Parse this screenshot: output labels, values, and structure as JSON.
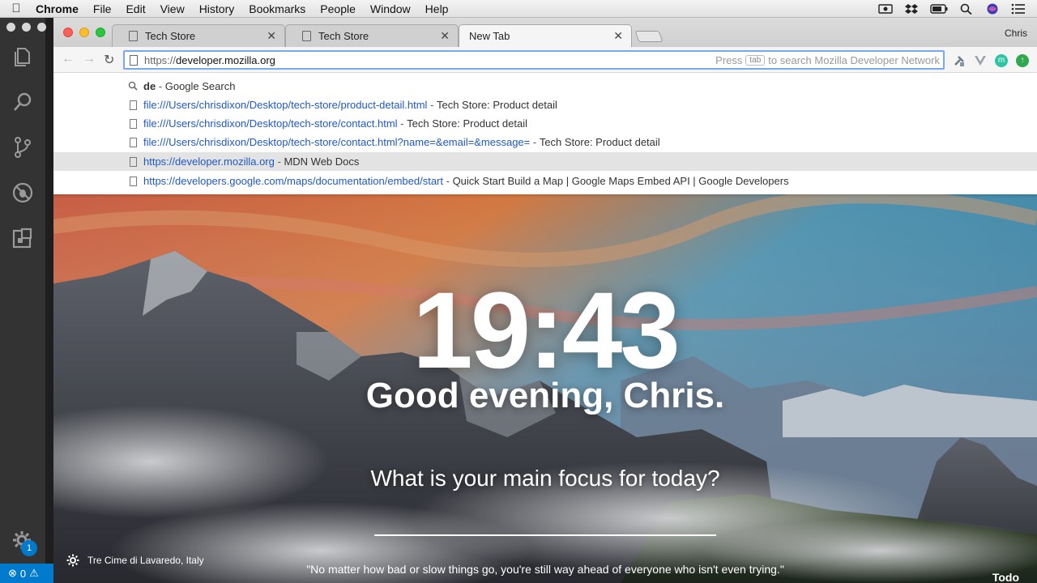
{
  "menubar": {
    "items": [
      "Chrome",
      "File",
      "Edit",
      "View",
      "History",
      "Bookmarks",
      "People",
      "Window",
      "Help"
    ]
  },
  "chrome": {
    "tabs": [
      {
        "title": "Tech Store"
      },
      {
        "title": "Tech Store"
      },
      {
        "title": "New Tab"
      }
    ],
    "profile_name": "Chris",
    "omnibox": {
      "scheme": "https://",
      "host": "developer.mozilla.org",
      "hint_press": "Press",
      "hint_key": "tab",
      "hint_rest": "to search Mozilla Developer Network"
    },
    "suggestions": [
      {
        "query": "de",
        "desc": "Google Search"
      },
      {
        "url": "file:///Users/chrisdixon/Desktop/tech-store/product-detail.html",
        "desc": "Tech Store: Product detail"
      },
      {
        "url": "file:///Users/chrisdixon/Desktop/tech-store/contact.html",
        "desc": "Tech Store: Product detail"
      },
      {
        "url": "file:///Users/chrisdixon/Desktop/tech-store/contact.html?name=&email=&message=",
        "desc": "Tech Store: Product detail"
      },
      {
        "url": "https://developer.mozilla.org",
        "desc": "MDN Web Docs"
      },
      {
        "url": "https://developers.google.com/maps/documentation/embed/start",
        "desc": "Quick Start Build a Map  |  Google Maps Embed API  |  Google Developers"
      }
    ]
  },
  "newtab": {
    "time": "19:43",
    "greeting": "Good evening, Chris.",
    "focus_prompt": "What is your main focus for today?",
    "location": "Tre Cime di Lavaredo, Italy",
    "quote": "\"No matter how bad or slow things go, you're still way ahead of everyone who isn't even trying.\"",
    "todo_label": "Todo"
  },
  "vscode": {
    "status_errors": "0",
    "notification_count": "1"
  },
  "colors": {
    "link_blue": "#1f58c6",
    "vscode_blue": "#007acc",
    "omnibox_focus": "#78a8f0"
  }
}
